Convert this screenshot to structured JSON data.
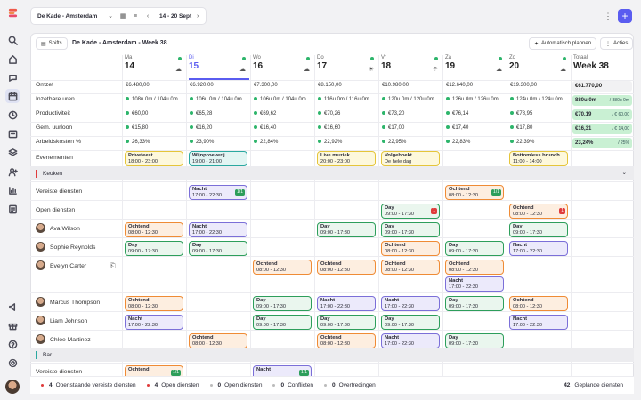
{
  "topbar": {
    "location": "De Kade - Amsterdam",
    "week_range": "14 - 20 Sept"
  },
  "toolbar": {
    "shifts_label": "Shifts",
    "title": "De Kade - Amsterdam - Week 38",
    "auto_plan": "Automatisch plannen",
    "actions": "Acties"
  },
  "days": [
    {
      "name": "Ma",
      "num": "14",
      "weather": "☁"
    },
    {
      "name": "Di",
      "num": "15",
      "weather": "☁"
    },
    {
      "name": "Wo",
      "num": "16",
      "weather": "☁"
    },
    {
      "name": "Do",
      "num": "17",
      "weather": "☀"
    },
    {
      "name": "Vr",
      "num": "18",
      "weather": "☂"
    },
    {
      "name": "Za",
      "num": "19",
      "weather": "☁"
    },
    {
      "name": "Zo",
      "num": "20",
      "weather": "☁"
    }
  ],
  "total_header": {
    "label": "Totaal",
    "week": "Week 38"
  },
  "metrics": [
    {
      "label": "Omzet",
      "values": [
        "€6.480,00",
        "€6.920,00",
        "€7.300,00",
        "€8.150,00",
        "€10.980,00",
        "€12.640,00",
        "€19.300,00"
      ],
      "total": "€61.770,00",
      "total_extra": ""
    },
    {
      "label": "Inzetbare uren",
      "values": [
        "108u 0m / 104u 0m",
        "106u 0m / 104u 0m",
        "106u 0m / 104u 0m",
        "116u 0m / 116u 0m",
        "120u 0m / 120u 0m",
        "126u 0m / 126u 0m",
        "124u 0m / 124u 0m"
      ],
      "total": "880u 0m",
      "total_extra": "/ 880u 0m"
    },
    {
      "label": "Productiviteit",
      "values": [
        "€60,00",
        "€65,28",
        "€69,62",
        "€70,26",
        "€73,20",
        "€76,14",
        "€78,95"
      ],
      "total": "€70,19",
      "total_extra": "/ € 60,00"
    },
    {
      "label": "Gem. uurloon",
      "values": [
        "€15,80",
        "€16,20",
        "€16,40",
        "€16,60",
        "€17,00",
        "€17,40",
        "€17,80"
      ],
      "total": "€16,31",
      "total_extra": "/ € 14,00"
    },
    {
      "label": "Arbeidskosten %",
      "values": [
        "26,33%",
        "23,90%",
        "22,84%",
        "22,92%",
        "22,95%",
        "22,83%",
        "22,39%"
      ],
      "total": "23,24%",
      "total_extra": "/ 25%"
    }
  ],
  "events_label": "Evenementen",
  "events": [
    {
      "day": 0,
      "title": "Privefeest",
      "time": "18:00 - 23:00",
      "style": "evt"
    },
    {
      "day": 1,
      "title": "Wijnproeverij",
      "time": "19:00 - 21:00",
      "style": "evt2"
    },
    {
      "day": 3,
      "title": "Live muziek",
      "time": "20:00 - 23:00",
      "style": "evt"
    },
    {
      "day": 4,
      "title": "Volgeboekt",
      "time": "De hele dag",
      "style": "evt"
    },
    {
      "day": 6,
      "title": "Bottomless brunch",
      "time": "11:00 - 14:00",
      "style": "evt"
    }
  ],
  "sections": {
    "kitchen": "Keuken",
    "bar": "Bar"
  },
  "rows": [
    {
      "label": "Vereiste diensten",
      "shifts": [
        {
          "day": 1,
          "type": "Nacht",
          "time": "17:00 - 22:30",
          "badge": "1/1",
          "bc": "#2d9e5b"
        },
        {
          "day": 5,
          "type": "Ochtend",
          "time": "08:00 - 12:30",
          "badge": "1/1",
          "bc": "#2d9e5b"
        }
      ]
    },
    {
      "label": "Open diensten",
      "shifts": [
        {
          "day": 4,
          "type": "Day",
          "time": "09:00 - 17:30",
          "badge": "1",
          "bc": "#e03b3b"
        },
        {
          "day": 6,
          "type": "Ochtend",
          "time": "08:00 - 12:30",
          "badge": "1",
          "bc": "#e03b3b"
        }
      ]
    },
    {
      "label": "Ava Wilson",
      "shifts": [
        {
          "day": 0,
          "type": "Ochtend",
          "time": "08:00 - 12:30"
        },
        {
          "day": 1,
          "type": "Nacht",
          "time": "17:00 - 22:30"
        },
        {
          "day": 3,
          "type": "Day",
          "time": "09:00 - 17:30"
        },
        {
          "day": 4,
          "type": "Day",
          "time": "09:00 - 17:30"
        },
        {
          "day": 6,
          "type": "Day",
          "time": "09:00 - 17:30"
        }
      ]
    },
    {
      "label": "Sophie Reynolds",
      "shifts": [
        {
          "day": 0,
          "type": "Day",
          "time": "09:00 - 17:30"
        },
        {
          "day": 1,
          "type": "Day",
          "time": "09:00 - 17:30"
        },
        {
          "day": 4,
          "type": "Ochtend",
          "time": "08:00 - 12:30"
        },
        {
          "day": 5,
          "type": "Day",
          "time": "09:00 - 17:30"
        },
        {
          "day": 6,
          "type": "Nacht",
          "time": "17:00 - 22:30"
        }
      ]
    },
    {
      "label": "Evelyn Carter",
      "shifts": [
        {
          "day": 2,
          "type": "Ochtend",
          "time": "08:00 - 12:30"
        },
        {
          "day": 3,
          "type": "Ochtend",
          "time": "08:00 - 12:30"
        },
        {
          "day": 4,
          "type": "Ochtend",
          "time": "08:00 - 12:30"
        },
        {
          "day": 5,
          "type": "Ochtend",
          "time": "08:00 - 12:30"
        },
        {
          "day": 5,
          "type": "Nacht",
          "time": "17:00 - 22:30",
          "second": true
        }
      ]
    },
    {
      "label": "Marcus Thompson",
      "shifts": [
        {
          "day": 0,
          "type": "Ochtend",
          "time": "08:00 - 12:30"
        },
        {
          "day": 2,
          "type": "Day",
          "time": "09:00 - 17:30"
        },
        {
          "day": 3,
          "type": "Nacht",
          "time": "17:00 - 22:30"
        },
        {
          "day": 4,
          "type": "Nacht",
          "time": "17:00 - 22:30"
        },
        {
          "day": 5,
          "type": "Day",
          "time": "09:00 - 17:30"
        },
        {
          "day": 6,
          "type": "Ochtend",
          "time": "08:00 - 12:30"
        }
      ]
    },
    {
      "label": "Liam Johnson",
      "shifts": [
        {
          "day": 0,
          "type": "Nacht",
          "time": "17:00 - 22:30"
        },
        {
          "day": 2,
          "type": "Day",
          "time": "09:00 - 17:30"
        },
        {
          "day": 3,
          "type": "Day",
          "time": "09:00 - 17:30"
        },
        {
          "day": 4,
          "type": "Day",
          "time": "09:00 - 17:30"
        },
        {
          "day": 6,
          "type": "Nacht",
          "time": "17:00 - 22:30"
        }
      ]
    },
    {
      "label": "Chloe Martinez",
      "shifts": [
        {
          "day": 1,
          "type": "Ochtend",
          "time": "08:00 - 12:30"
        },
        {
          "day": 3,
          "type": "Ochtend",
          "time": "08:00 - 12:30"
        },
        {
          "day": 4,
          "type": "Nacht",
          "time": "17:00 - 22:30"
        },
        {
          "day": 5,
          "type": "Day",
          "time": "09:00 - 17:30"
        }
      ]
    },
    {
      "label": "Vereiste diensten",
      "shifts": [
        {
          "day": 0,
          "type": "Ochtend",
          "time": "",
          "badge": "1/1",
          "bc": "#2d9e5b"
        },
        {
          "day": 2,
          "type": "Nacht",
          "time": "",
          "badge": "1/1",
          "bc": "#2d9e5b"
        }
      ]
    }
  ],
  "footer": [
    {
      "value": "4",
      "label": "Openstaande vereiste diensten",
      "color": "#e03b3b"
    },
    {
      "value": "4",
      "label": "Open diensten",
      "color": "#e03b3b"
    },
    {
      "value": "0",
      "label": "Open diensten",
      "color": "#bbbbbb"
    },
    {
      "value": "0",
      "label": "Conflicten",
      "color": "#bbbbbb"
    },
    {
      "value": "0",
      "label": "Overtredingen",
      "color": "#bbbbbb"
    }
  ],
  "footer_right": {
    "value": "42",
    "label": "Geplande diensten"
  }
}
